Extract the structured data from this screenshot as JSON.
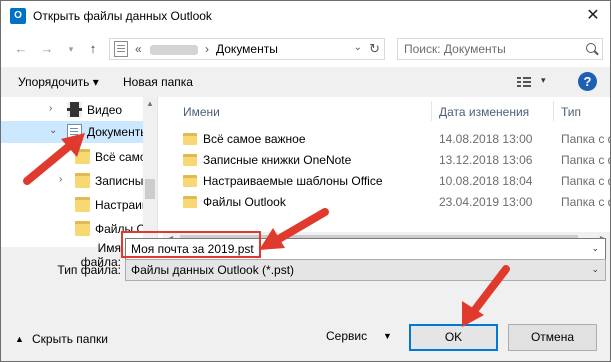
{
  "window": {
    "title": "Открыть файлы данных Outlook",
    "app_icon_letter": "O",
    "close_symbol": "✕"
  },
  "address": {
    "prefix": "«",
    "separator": "›",
    "current": "Документы"
  },
  "search": {
    "placeholder": "Поиск: Документы"
  },
  "toolbar": {
    "organize_label": "Упорядочить ▾",
    "new_folder_label": "Новая папка",
    "help_label": "?"
  },
  "nav_tree": {
    "items": [
      {
        "label": "Видео",
        "icon": "video-icon",
        "arrow": "›",
        "selected": false
      },
      {
        "label": "Документы",
        "icon": "document-icon",
        "arrow": "⌄",
        "selected": true
      },
      {
        "label": "Всё самое важное",
        "icon": "folder-icon",
        "arrow": "",
        "selected": false
      },
      {
        "label": "Записные книжки OneNote",
        "icon": "folder-icon",
        "arrow": "›",
        "selected": false
      },
      {
        "label": "Настраиваемые шаблоны Office",
        "icon": "folder-icon",
        "arrow": "",
        "selected": false
      },
      {
        "label": "Файлы Outlook",
        "icon": "folder-icon",
        "arrow": "",
        "selected": false
      }
    ]
  },
  "file_list": {
    "columns": {
      "name": "Имени",
      "date": "Дата изменения",
      "type": "Тип"
    },
    "rows": [
      {
        "name": "Всё самое важное",
        "date": "14.08.2018 13:00",
        "type": "Папка с файлами"
      },
      {
        "name": "Записные книжки OneNote",
        "date": "13.12.2018 13:06",
        "type": "Папка с файлами"
      },
      {
        "name": "Настраиваемые шаблоны Office",
        "date": "10.08.2018 18:04",
        "type": "Папка с файлами"
      },
      {
        "name": "Файлы Outlook",
        "date": "23.04.2019 13:00",
        "type": "Папка с файлами"
      }
    ]
  },
  "form": {
    "filename_label": "Имя файла:",
    "filename_value": "Моя почта за 2019.pst",
    "filetype_label": "Тип файла:",
    "filetype_value": "Файлы данных Outlook (*.pst)"
  },
  "footer": {
    "hide_folders_label": "Скрыть папки",
    "service_label": "Сервис",
    "ok_label": "OK",
    "cancel_label": "Отмена"
  },
  "colors": {
    "accent": "#0078d7",
    "selection": "#cce8ff",
    "annotation_red": "#e03a2f",
    "outlook_blue": "#0072c6"
  }
}
